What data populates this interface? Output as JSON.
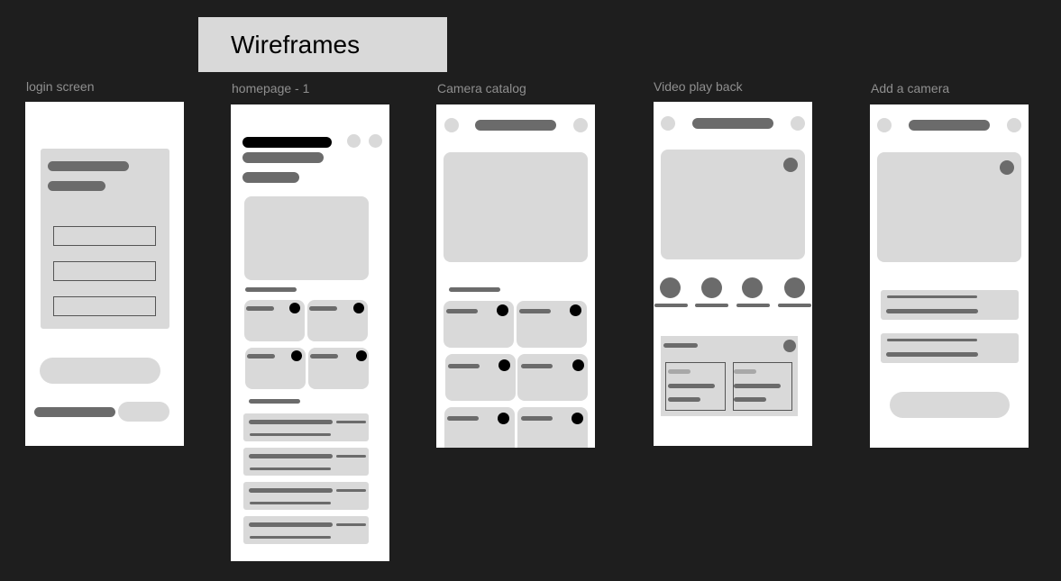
{
  "canvas": {
    "background": "#1e1e1e",
    "frame_color": "#ffffff",
    "placeholder_light": "#d9d9d9",
    "placeholder_dark": "#6b6b6b"
  },
  "title": "Wireframes",
  "frames": {
    "login": {
      "label": "login screen"
    },
    "homepage": {
      "label": "homepage - 1"
    },
    "catalog": {
      "label": "Camera catalog"
    },
    "video": {
      "label": "Video play back"
    },
    "add": {
      "label": "Add a camera"
    }
  }
}
